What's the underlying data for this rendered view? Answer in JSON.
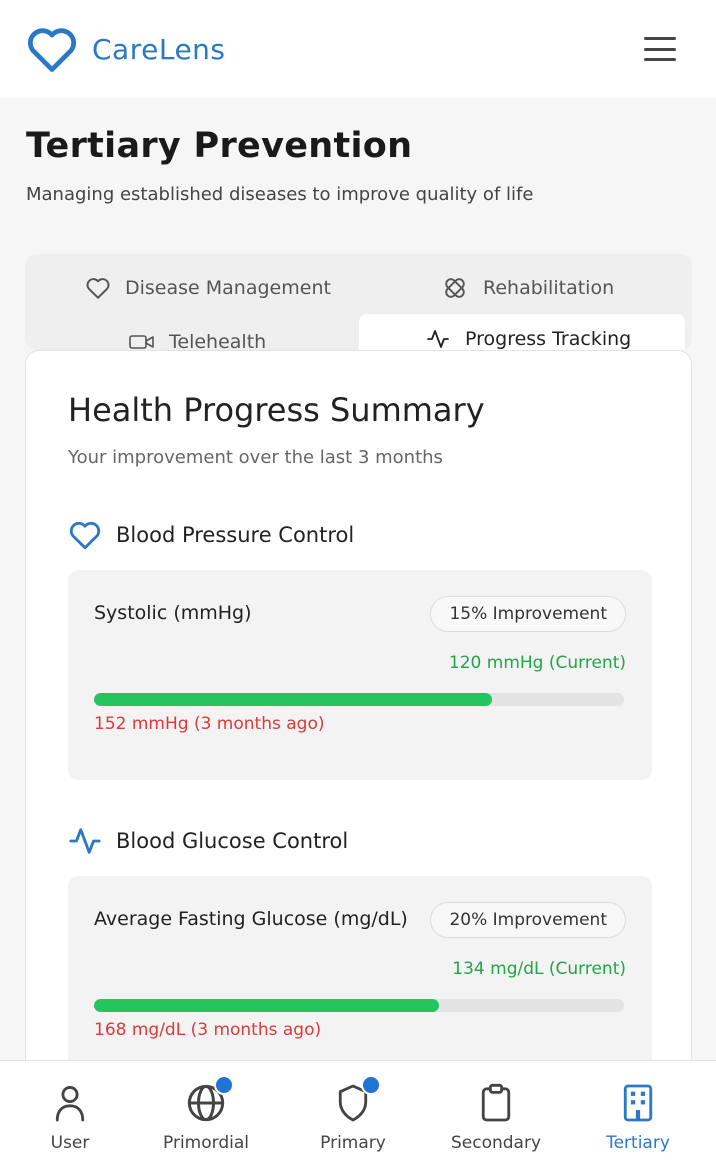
{
  "app": {
    "name": "CareLens"
  },
  "page": {
    "title": "Tertiary Prevention",
    "subtitle": "Managing established diseases to improve quality of life"
  },
  "tabs": [
    {
      "label": "Disease Management",
      "icon": "heart-icon"
    },
    {
      "label": "Rehabilitation",
      "icon": "bandage-icon"
    },
    {
      "label": "Telehealth",
      "icon": "video-icon"
    },
    {
      "label": "Progress Tracking",
      "icon": "activity-icon",
      "active": true
    }
  ],
  "summary": {
    "title": "Health Progress Summary",
    "subtitle": "Your improvement over the last 3 months",
    "sections": [
      {
        "title": "Blood Pressure Control",
        "icon": "heart-icon",
        "metric": {
          "label": "Systolic (mmHg)",
          "badge": "15% Improvement",
          "current": "120 mmHg (Current)",
          "previous": "152 mmHg (3 months ago)",
          "progress": 0.75
        }
      },
      {
        "title": "Blood Glucose Control",
        "icon": "activity-icon",
        "metric": {
          "label": "Average Fasting Glucose (mg/dL)",
          "badge": "20% Improvement",
          "current": "134 mg/dL (Current)",
          "previous": "168 mg/dL (3 months ago)",
          "progress": 0.65
        }
      }
    ]
  },
  "bottom_nav": [
    {
      "label": "User",
      "icon": "user-icon",
      "badge": false
    },
    {
      "label": "Primordial",
      "icon": "globe-icon",
      "badge": true
    },
    {
      "label": "Primary",
      "icon": "shield-icon",
      "badge": true
    },
    {
      "label": "Secondary",
      "icon": "clipboard-icon",
      "badge": false
    },
    {
      "label": "Tertiary",
      "icon": "building-icon",
      "badge": false,
      "active": true
    }
  ],
  "colors": {
    "brand": "#2a78c6",
    "progress": "#22c55e",
    "current": "#22a447",
    "previous": "#d93a3a",
    "badge_dot": "#1f74d6"
  }
}
